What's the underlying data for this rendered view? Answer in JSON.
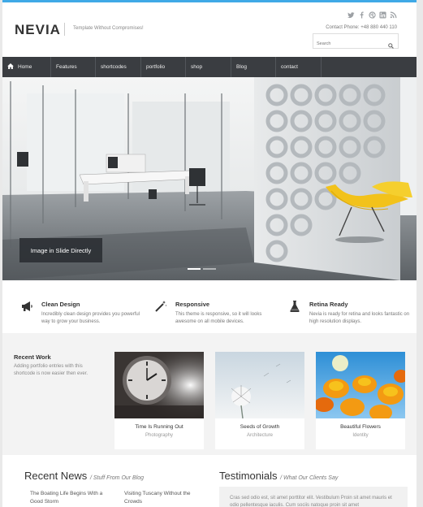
{
  "header": {
    "logo": "NEVIA",
    "tagline": "Template Without Compromises!",
    "contact": "Contact Phone: +48 880 440 110",
    "search_placeholder": "Search",
    "social": [
      "twitter-icon",
      "facebook-icon",
      "dribbble-icon",
      "linkedin-icon",
      "rss-icon"
    ]
  },
  "nav": {
    "items": [
      {
        "label": "Home",
        "icon": "home-icon"
      },
      {
        "label": "Features"
      },
      {
        "label": "shortcodes"
      },
      {
        "label": "portfolio"
      },
      {
        "label": "shop"
      },
      {
        "label": "Blog"
      },
      {
        "label": "contact"
      }
    ]
  },
  "slider": {
    "caption": "Image in Slide Directly"
  },
  "features": [
    {
      "icon": "megaphone-icon",
      "title": "Clean Design",
      "text": "Incredibly clean design provides you powerful way to grow your business."
    },
    {
      "icon": "magic-wand-icon",
      "title": "Responsive",
      "text": "This theme is responsive, so it will looks awesome on all mobile devices."
    },
    {
      "icon": "flask-icon",
      "title": "Retina Ready",
      "text": "Nevia is ready for retina and looks fantastic on high resolution displays."
    }
  ],
  "portfolio": {
    "title": "Recent Work",
    "description": "Adding portfolio entries with this shortcode is now easier then ever.",
    "items": [
      {
        "title": "Time Is Running Out",
        "category": "Photography"
      },
      {
        "title": "Seeds of Growth",
        "category": "Architecture"
      },
      {
        "title": "Beautiful Flowers",
        "category": "Identity"
      }
    ]
  },
  "news": {
    "title": "Recent News",
    "subtitle": "/ Stuff From Our Blog",
    "items": [
      "The Boating Life Begins With a Good Storm",
      "Visiting Tuscany Without the Crowds"
    ]
  },
  "testimonials": {
    "title": "Testimonials",
    "subtitle": "/ What Our Clients Say",
    "text": "Cras sed odio est, sit amet porttitor elit. Vestibulum Proin sit amet mauris et odio pellentesque iaculis. Cum sociis natoque proin sit amet"
  },
  "colors": {
    "accent": "#3fa9e6",
    "nav_bg": "#3a3d41"
  }
}
